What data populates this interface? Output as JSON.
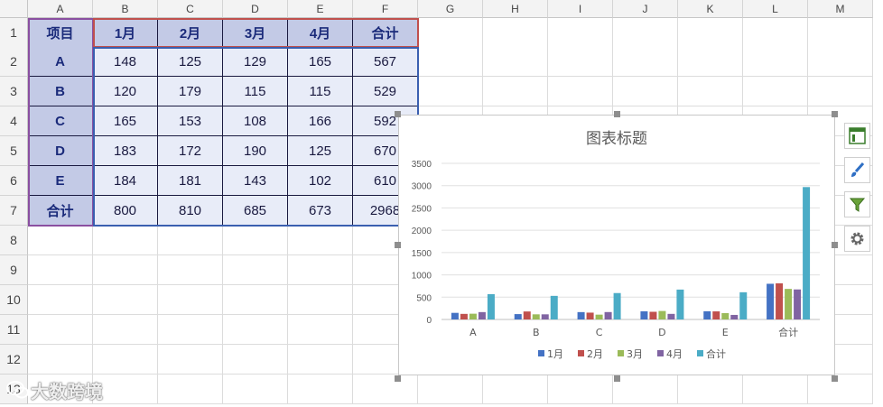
{
  "sheet": {
    "columns": [
      "A",
      "B",
      "C",
      "D",
      "E",
      "F",
      "G",
      "H",
      "I",
      "J",
      "K",
      "L",
      "M"
    ],
    "rows": [
      "1",
      "2",
      "3",
      "4",
      "5",
      "6",
      "7",
      "8",
      "9",
      "10",
      "11",
      "12",
      "13"
    ],
    "table": {
      "header": [
        "项目",
        "1月",
        "2月",
        "3月",
        "4月",
        "合计"
      ],
      "body": [
        [
          "A",
          "148",
          "125",
          "129",
          "165",
          "567"
        ],
        [
          "B",
          "120",
          "179",
          "115",
          "115",
          "529"
        ],
        [
          "C",
          "165",
          "153",
          "108",
          "166",
          "592"
        ],
        [
          "D",
          "183",
          "172",
          "190",
          "125",
          "670"
        ],
        [
          "E",
          "184",
          "181",
          "143",
          "102",
          "610"
        ],
        [
          "合计",
          "800",
          "810",
          "685",
          "673",
          "2968"
        ]
      ]
    }
  },
  "chart_data": {
    "type": "bar",
    "title": "图表标题",
    "categories": [
      "A",
      "B",
      "C",
      "D",
      "E",
      "合计"
    ],
    "series": [
      {
        "name": "1月",
        "color": "#4472c4",
        "values": [
          148,
          120,
          165,
          183,
          184,
          800
        ]
      },
      {
        "name": "2月",
        "color": "#c0504d",
        "values": [
          125,
          179,
          153,
          172,
          181,
          810
        ]
      },
      {
        "name": "3月",
        "color": "#9bbb59",
        "values": [
          129,
          115,
          108,
          190,
          143,
          685
        ]
      },
      {
        "name": "4月",
        "color": "#8064a2",
        "values": [
          165,
          115,
          166,
          125,
          102,
          673
        ]
      },
      {
        "name": "合计",
        "color": "#4bacc6",
        "values": [
          567,
          529,
          592,
          670,
          610,
          2968
        ]
      }
    ],
    "ylim": [
      0,
      3500
    ],
    "yticks": [
      "0",
      "500",
      "1000",
      "1500",
      "2000",
      "2500",
      "3000",
      "3500"
    ],
    "grid": true,
    "legend": "bottom"
  },
  "side_buttons": [
    {
      "icon": "chart-elements-icon"
    },
    {
      "icon": "chart-styles-icon"
    },
    {
      "icon": "chart-filters-icon"
    },
    {
      "icon": "settings-gear-icon"
    }
  ],
  "watermark": {
    "text": "大数跨境"
  }
}
